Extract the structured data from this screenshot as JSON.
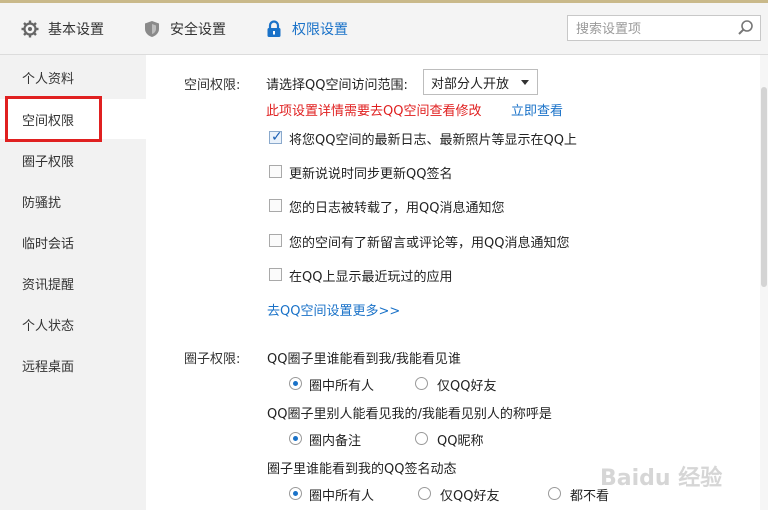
{
  "tabs": [
    {
      "label": "基本设置",
      "icon": "gear-icon"
    },
    {
      "label": "安全设置",
      "icon": "shield-icon"
    },
    {
      "label": "权限设置",
      "icon": "lock-icon"
    }
  ],
  "search": {
    "placeholder": "搜索设置项",
    "icon": "search-icon"
  },
  "sidebar": {
    "items": [
      {
        "label": "个人资料"
      },
      {
        "label": "空间权限"
      },
      {
        "label": "圈子权限"
      },
      {
        "label": "防骚扰"
      },
      {
        "label": "临时会话"
      },
      {
        "label": "资讯提醒"
      },
      {
        "label": "个人状态"
      },
      {
        "label": "远程桌面"
      }
    ]
  },
  "space": {
    "section_label": "空间权限:",
    "range_label": "请选择QQ空间访问范围:",
    "range_value": "对部分人开放",
    "notice": "此项设置详情需要去QQ空间查看修改",
    "view_now": "立即查看",
    "options": [
      {
        "label": "将您QQ空间的最新日志、最新照片等显示在QQ上",
        "checked": true
      },
      {
        "label": "更新说说时同步更新QQ签名",
        "checked": false
      },
      {
        "label": "您的日志被转载了，用QQ消息通知您",
        "checked": false
      },
      {
        "label": "您的空间有了新留言或评论等，用QQ消息通知您",
        "checked": false
      },
      {
        "label": "在QQ上显示最近玩过的应用",
        "checked": false
      }
    ],
    "more_link": "去QQ空间设置更多>>"
  },
  "circle": {
    "section_label": "圈子权限:",
    "q1": "QQ圈子里谁能看到我/我能看见谁",
    "q1_opts": [
      "圈中所有人",
      "仅QQ好友"
    ],
    "q2": "QQ圈子里别人能看见我的/我能看见别人的称呼是",
    "q2_opts": [
      "圈内备注",
      "QQ昵称"
    ],
    "q3": "圈子里谁能看到我的QQ签名动态",
    "q3_opts": [
      "圈中所有人",
      "仅QQ好友",
      "都不看"
    ]
  },
  "watermark": "Baidu 经验"
}
